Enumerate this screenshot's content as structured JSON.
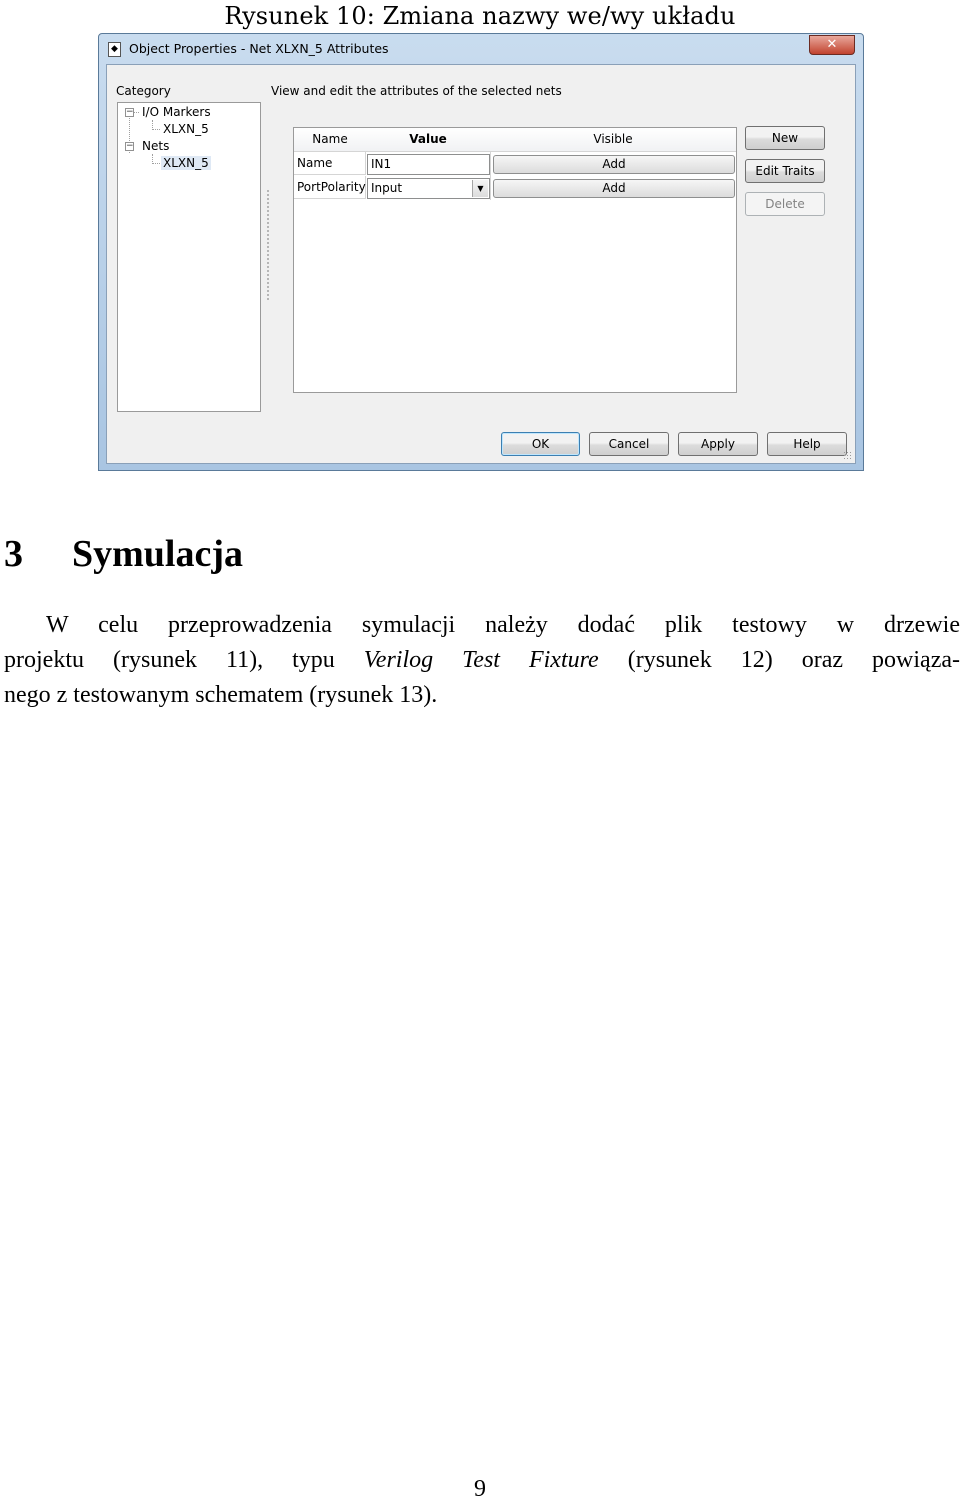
{
  "caption": "Rysunek 10: Zmiana nazwy we/wy układu",
  "dialog": {
    "title": "Object Properties - Net XLXN_5 Attributes",
    "close_glyph": "✕",
    "category_label": "Category",
    "description": "View and edit the attributes of the selected nets",
    "tree": {
      "io_markers": "I/O Markers",
      "io_child": "XLXN_5",
      "nets": "Nets",
      "nets_child": "XLXN_5"
    },
    "grid": {
      "headers": [
        "Name",
        "Value",
        "Visible"
      ],
      "rows": [
        {
          "name": "Name",
          "value": "IN1",
          "visible": "Add"
        },
        {
          "name": "PortPolarity",
          "value": "Input",
          "visible": "Add"
        }
      ]
    },
    "side_buttons": {
      "new": "New",
      "edit_traits": "Edit Traits",
      "delete": "Delete"
    },
    "bottom_buttons": {
      "ok": "OK",
      "cancel": "Cancel",
      "apply": "Apply",
      "help": "Help"
    }
  },
  "section": {
    "number": "3",
    "title": "Symulacja"
  },
  "paragraph": {
    "line1": "W celu przeprowadzenia symulacji należy dodać plik testowy w drzewie",
    "line2_a": "projektu (rysunek 11), typu ",
    "line2_em": "Verilog Test Fixture",
    "line2_b": " (rysunek 12) oraz powiąza-",
    "line3": "nego z testowanym schematem (rysunek 13)."
  },
  "page_number": "9"
}
